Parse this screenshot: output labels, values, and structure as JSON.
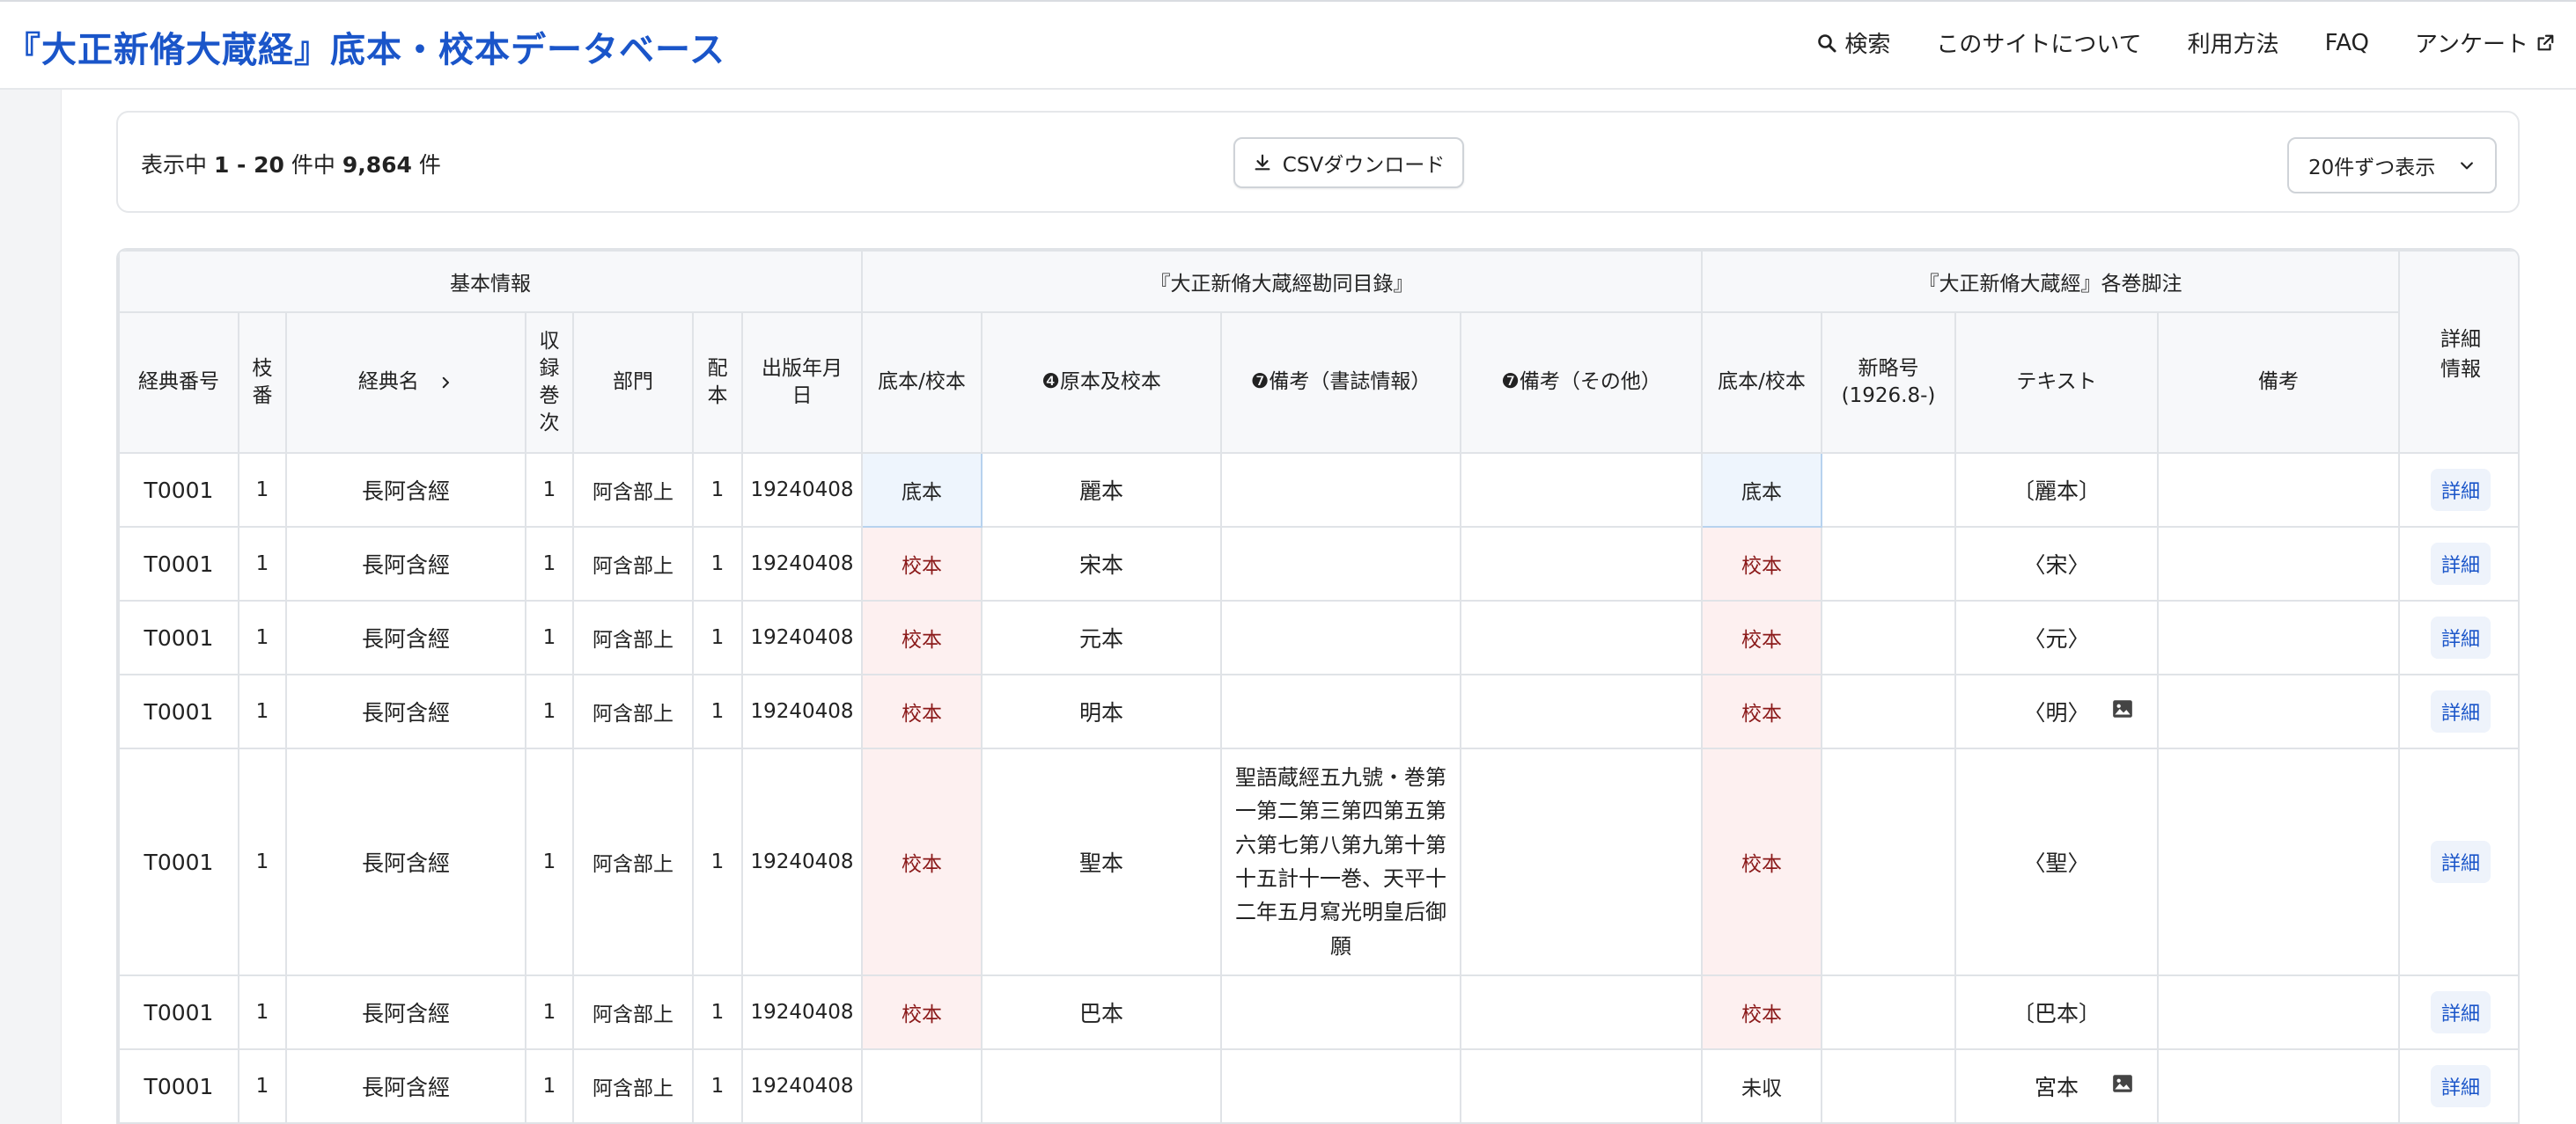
{
  "header": {
    "title": "『大正新脩大蔵経』底本・校本データベース",
    "nav": [
      {
        "label": "検索",
        "icon": "search-icon"
      },
      {
        "label": "このサイトについて"
      },
      {
        "label": "利用方法"
      },
      {
        "label": "FAQ"
      },
      {
        "label": "アンケート",
        "icon": "external-link-icon"
      }
    ]
  },
  "toolbar": {
    "count_prefix": "表示中 ",
    "count_range": "1 - 20",
    "count_mid": " 件中 ",
    "count_total": "9,864",
    "count_suffix": " 件",
    "csv_label": "CSVダウンロード",
    "per_page_label": "20件ずつ表示"
  },
  "table": {
    "groups": [
      "基本情報",
      "『大正新脩大蔵經勘同目錄』",
      "『大正新脩大蔵經』各巻脚注"
    ],
    "columns": {
      "sutra_no": "経典番号",
      "branch": "枝番",
      "sutra_name": "経典名",
      "volume": "収録巻次",
      "section": "部門",
      "edition": "配本",
      "pub_date": "出版年月日",
      "kd_type": "底本/校本",
      "kd_source": "❹原本及校本",
      "kd_note_biblio": "❼備考（書誌情報）",
      "kd_note_other": "❼備考（その他）",
      "fn_type": "底本/校本",
      "fn_newcode": "新略号\n(1926.8-)",
      "fn_text": "テキスト",
      "fn_note": "備考",
      "detail": "詳細情報"
    },
    "rows": [
      {
        "no": "T0001",
        "branch": "1",
        "name": "長阿含經",
        "vol": "1",
        "section": "阿含部上",
        "edition": "1",
        "date": "19240408",
        "kd_type": "底本",
        "kd_source": "麗本",
        "kd_note_biblio": "",
        "kd_note_other": "",
        "fn_type": "底本",
        "fn_newcode": "",
        "fn_text": "〔麗本〕",
        "fn_note": "",
        "detail": "詳細",
        "has_image": false
      },
      {
        "no": "T0001",
        "branch": "1",
        "name": "長阿含經",
        "vol": "1",
        "section": "阿含部上",
        "edition": "1",
        "date": "19240408",
        "kd_type": "校本",
        "kd_source": "宋本",
        "kd_note_biblio": "",
        "kd_note_other": "",
        "fn_type": "校本",
        "fn_newcode": "",
        "fn_text": "〈宋〉",
        "fn_note": "",
        "detail": "詳細",
        "has_image": false
      },
      {
        "no": "T0001",
        "branch": "1",
        "name": "長阿含經",
        "vol": "1",
        "section": "阿含部上",
        "edition": "1",
        "date": "19240408",
        "kd_type": "校本",
        "kd_source": "元本",
        "kd_note_biblio": "",
        "kd_note_other": "",
        "fn_type": "校本",
        "fn_newcode": "",
        "fn_text": "〈元〉",
        "fn_note": "",
        "detail": "詳細",
        "has_image": false
      },
      {
        "no": "T0001",
        "branch": "1",
        "name": "長阿含經",
        "vol": "1",
        "section": "阿含部上",
        "edition": "1",
        "date": "19240408",
        "kd_type": "校本",
        "kd_source": "明本",
        "kd_note_biblio": "",
        "kd_note_other": "",
        "fn_type": "校本",
        "fn_newcode": "",
        "fn_text": "〈明〉",
        "fn_note": "",
        "detail": "詳細",
        "has_image": true
      },
      {
        "no": "T0001",
        "branch": "1",
        "name": "長阿含經",
        "vol": "1",
        "section": "阿含部上",
        "edition": "1",
        "date": "19240408",
        "kd_type": "校本",
        "kd_source": "聖本",
        "kd_note_biblio": "聖語蔵經五九號・巻第一第二第三第四第五第六第七第八第九第十第十五計十一巻、天平十二年五月寫光明皇后御願",
        "kd_note_other": "",
        "fn_type": "校本",
        "fn_newcode": "",
        "fn_text": "〈聖〉",
        "fn_note": "",
        "detail": "詳細",
        "has_image": false
      },
      {
        "no": "T0001",
        "branch": "1",
        "name": "長阿含經",
        "vol": "1",
        "section": "阿含部上",
        "edition": "1",
        "date": "19240408",
        "kd_type": "校本",
        "kd_source": "巴本",
        "kd_note_biblio": "",
        "kd_note_other": "",
        "fn_type": "校本",
        "fn_newcode": "",
        "fn_text": "〔巴本〕",
        "fn_note": "",
        "detail": "詳細",
        "has_image": false
      },
      {
        "no": "T0001",
        "branch": "1",
        "name": "長阿含經",
        "vol": "1",
        "section": "阿含部上",
        "edition": "1",
        "date": "19240408",
        "kd_type": "",
        "kd_source": "",
        "kd_note_biblio": "",
        "kd_note_other": "",
        "fn_type": "未収",
        "fn_newcode": "",
        "fn_text": "宮本",
        "fn_note": "",
        "detail": "詳細",
        "has_image": true
      }
    ]
  },
  "colors": {
    "brand": "#1a55c9",
    "shiji_text": "#8b1a1a",
    "shiji_bg": "#fdf0f0",
    "teihon_bg": "#eef5fd"
  }
}
